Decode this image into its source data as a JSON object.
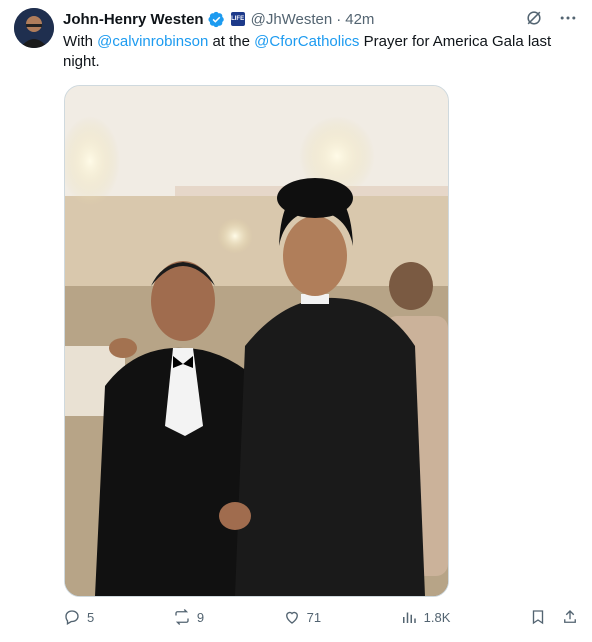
{
  "post": {
    "author_name": "John-Henry Westen",
    "handle": "@JhWesten",
    "separator": "·",
    "time": "42m",
    "affiliation_badge": "LIFE",
    "text": {
      "part1": "With ",
      "mention1": "@calvinrobinson",
      "part2": " at the ",
      "mention2": "@CforCatholics",
      "part3": " Prayer for America Gala last night."
    }
  },
  "stats": {
    "replies": "5",
    "reposts": "9",
    "likes": "71",
    "views": "1.8K"
  },
  "colors": {
    "link": "#1d9bf0",
    "muted": "#536471",
    "text": "#0f1419",
    "verified": "#1d9bf0"
  },
  "icons": [
    "grok-icon",
    "more-icon",
    "reply-icon",
    "repost-icon",
    "like-icon",
    "views-icon",
    "bookmark-icon",
    "share-icon"
  ]
}
